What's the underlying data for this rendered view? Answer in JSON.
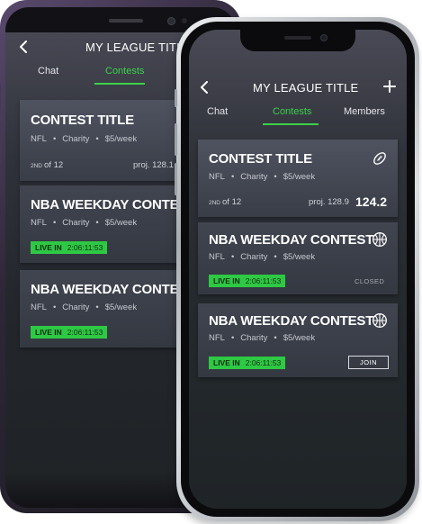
{
  "header": {
    "title": "MY LEAGUE TITLE"
  },
  "tabs": [
    {
      "label": "Chat",
      "active": false
    },
    {
      "label": "Contests",
      "active": true
    },
    {
      "label": "Members",
      "active": false
    }
  ],
  "contests": [
    {
      "title": "CONTEST TITLE",
      "league": "NFL",
      "type": "Charity",
      "fee": "$5/week",
      "rank_place": "2ND",
      "rank_of": "of 12",
      "proj": "proj. 128.9",
      "score": "124.2",
      "icon": "football-icon"
    },
    {
      "title": "NBA WEEKDAY CONTEST",
      "league": "NFL",
      "type": "Charity",
      "fee": "$5/week",
      "live_label": "LIVE IN",
      "live_time": "2:06:11:53",
      "status": "CLOSED",
      "icon": "basketball-icon"
    },
    {
      "title": "NBA WEEKDAY CONTEST",
      "league": "NFL",
      "type": "Charity",
      "fee": "$5/week",
      "live_label": "LIVE IN",
      "live_time": "2:06:11:53",
      "action": "JOIN",
      "icon": "basketball-icon"
    }
  ],
  "back_phone": {
    "proj_partial": "proj. 128.1"
  },
  "colors": {
    "accent": "#39d24a",
    "live_badge": "#2ec944",
    "card": "#434751",
    "background": "#252a2e"
  }
}
